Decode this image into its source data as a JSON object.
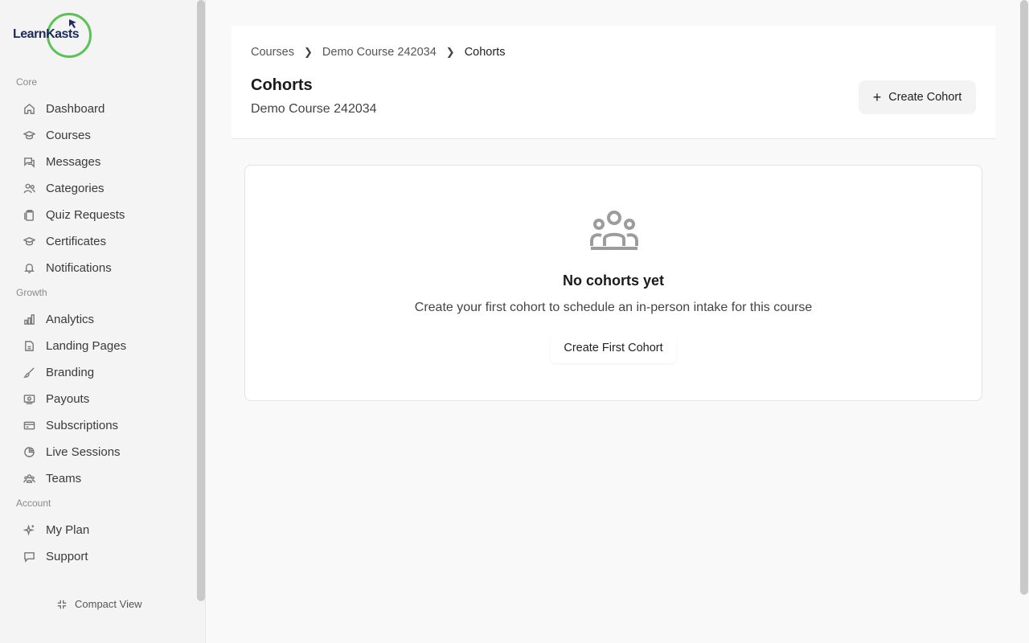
{
  "brand": {
    "name": "LearnKasts"
  },
  "sidebar": {
    "sections": [
      {
        "label": "Core"
      },
      {
        "label": "Growth"
      },
      {
        "label": "Account"
      }
    ],
    "items": [
      {
        "label": "Dashboard",
        "icon": "home-icon"
      },
      {
        "label": "Courses",
        "icon": "graduation-cap-icon"
      },
      {
        "label": "Messages",
        "icon": "messages-icon"
      },
      {
        "label": "Categories",
        "icon": "users-icon"
      },
      {
        "label": "Quiz Requests",
        "icon": "clipboard-icon"
      },
      {
        "label": "Certificates",
        "icon": "graduation-cap-icon"
      },
      {
        "label": "Notifications",
        "icon": "bell-icon"
      },
      {
        "label": "Analytics",
        "icon": "bar-chart-icon"
      },
      {
        "label": "Landing Pages",
        "icon": "file-icon"
      },
      {
        "label": "Branding",
        "icon": "brush-icon"
      },
      {
        "label": "Payouts",
        "icon": "banknote-icon"
      },
      {
        "label": "Subscriptions",
        "icon": "credit-card-icon"
      },
      {
        "label": "Live Sessions",
        "icon": "pie-chart-icon"
      },
      {
        "label": "Teams",
        "icon": "team-icon"
      },
      {
        "label": "My Plan",
        "icon": "sparkles-icon"
      },
      {
        "label": "Support",
        "icon": "message-square-icon"
      }
    ],
    "compact_label": "Compact View"
  },
  "breadcrumb": {
    "items": [
      "Courses",
      "Demo Course 242034",
      "Cohorts"
    ]
  },
  "header": {
    "title": "Cohorts",
    "subtitle": "Demo Course 242034",
    "create_label": "Create Cohort"
  },
  "empty_state": {
    "icon": "people-group-icon",
    "title": "No cohorts yet",
    "description": "Create your first cohort to schedule an in-person intake for this course",
    "button_label": "Create First Cohort"
  },
  "colors": {
    "accent_green": "#5bc256",
    "brand_navy": "#1d2a5c"
  }
}
